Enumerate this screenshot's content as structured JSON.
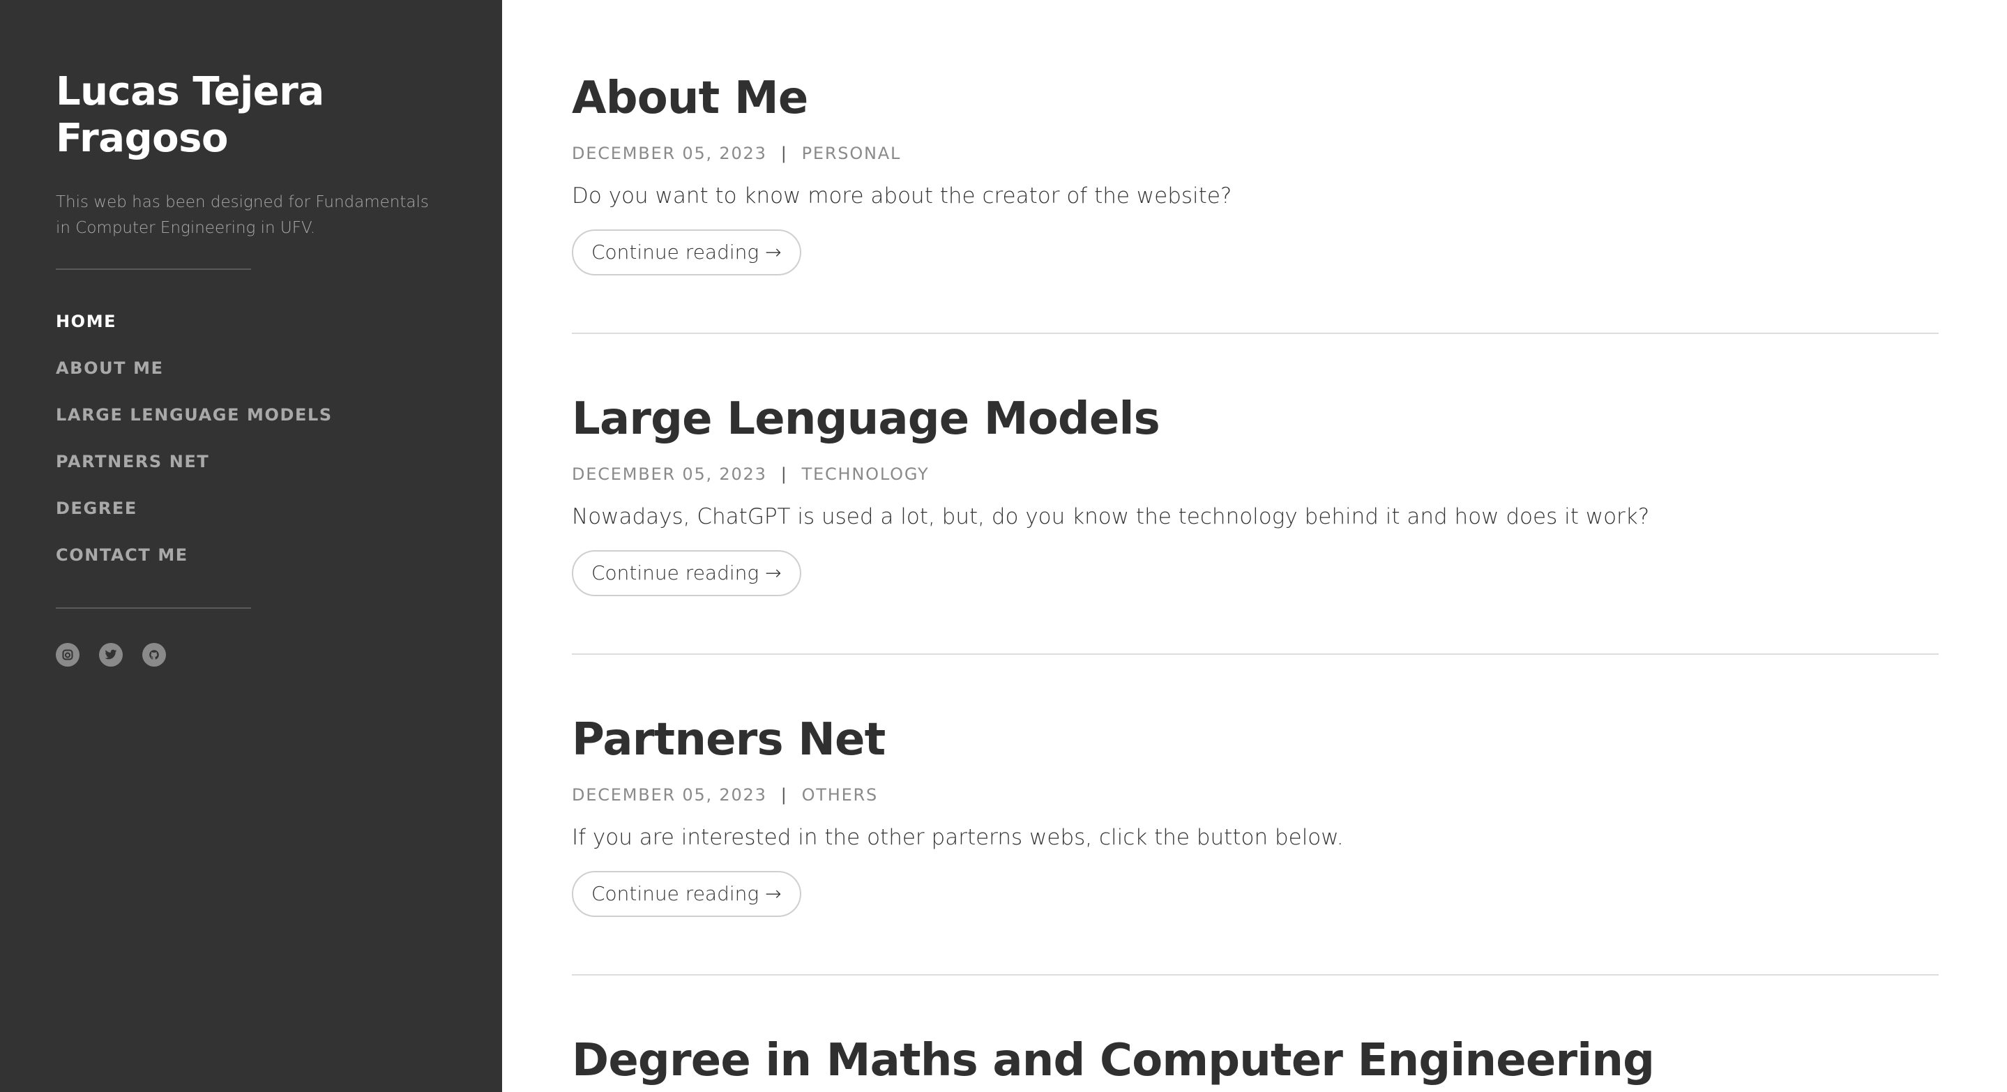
{
  "sidebar": {
    "title_line1": "Lucas Tejera",
    "title_line2": "Fragoso",
    "description": "This web has been designed for Fundamentals in Computer Engineering in UFV.",
    "nav": [
      {
        "label": "HOME",
        "active": true
      },
      {
        "label": "ABOUT ME"
      },
      {
        "label": "LARGE LENGUAGE MODELS"
      },
      {
        "label": "PARTNERS NET"
      },
      {
        "label": "DEGREE"
      },
      {
        "label": "CONTACT ME"
      }
    ],
    "social_icons": [
      "instagram-icon",
      "twitter-icon",
      "github-icon"
    ]
  },
  "posts": [
    {
      "title": "About Me",
      "date": "DECEMBER 05, 2023",
      "separator": "|",
      "category": "PERSONAL",
      "excerpt": "Do you want to know more about the creator of the website?",
      "button": "Continue reading →"
    },
    {
      "title": "Large Lenguage Models",
      "date": "DECEMBER 05, 2023",
      "separator": "|",
      "category": "TECHNOLOGY",
      "excerpt": "Nowadays, ChatGPT is used a lot, but, do you know the technology behind it and how does it work?",
      "button": "Continue reading →"
    },
    {
      "title": "Partners Net",
      "date": "DECEMBER 05, 2023",
      "separator": "|",
      "category": "OTHERS",
      "excerpt": "If you are interested in the other parterns webs, click the button below.",
      "button": "Continue reading →"
    },
    {
      "title": "Degree in Maths and Computer Engineering"
    }
  ],
  "colors": {
    "sidebar_bg": "#333333",
    "nav_active": "#ffffff",
    "nav_inactive": "#a9a9a9",
    "meta_text": "#8a8a8a",
    "divider": "#dddddd"
  }
}
